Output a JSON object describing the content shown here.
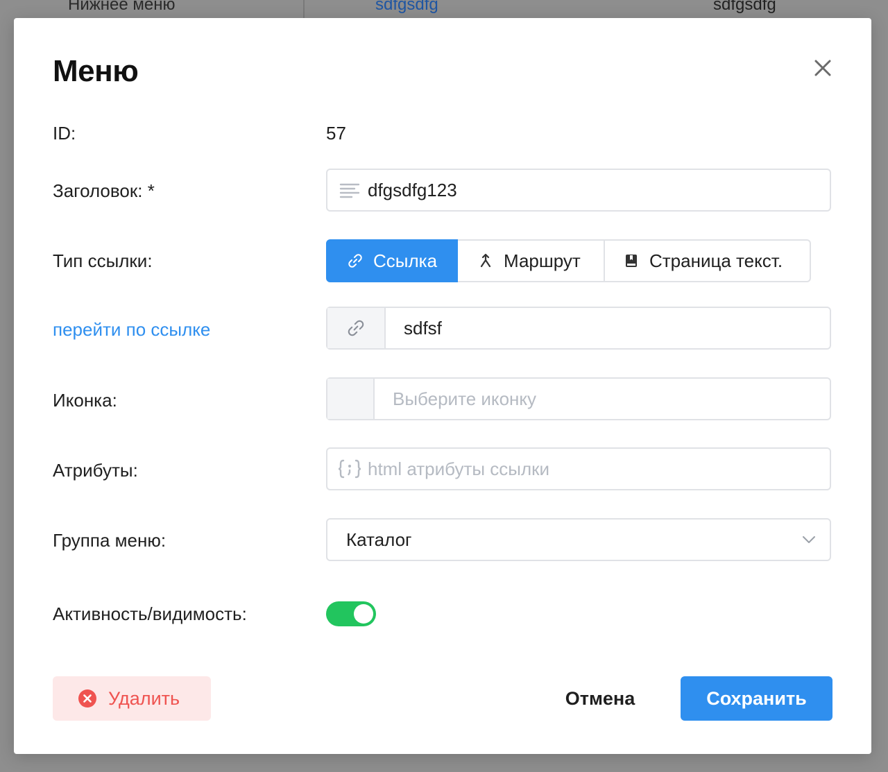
{
  "background": {
    "row_left": "Нижнее меню",
    "row_link": "sdfgsdfg",
    "row_right": "sdfgsdfg"
  },
  "modal": {
    "title": "Меню",
    "id_label": "ID:",
    "id_value": "57",
    "title_label": "Заголовок: *",
    "title_value": "dfgsdfg123",
    "link_type_label": "Тип ссылки:",
    "link_types": [
      {
        "label": "Ссылка",
        "icon": "link-icon",
        "active": true
      },
      {
        "label": "Маршрут",
        "icon": "route-icon",
        "active": false
      },
      {
        "label": "Страница текст.",
        "icon": "book-icon",
        "active": false
      }
    ],
    "goto_link_label": "перейти по ссылке",
    "url_value": "sdfsf",
    "icon_label": "Иконка:",
    "icon_placeholder": "Выберите иконку",
    "attributes_label": "Атрибуты:",
    "attributes_placeholder": "html атрибуты ссылки",
    "menu_group_label": "Группа меню:",
    "menu_group_value": "Каталог",
    "active_label": "Активность/видимость:",
    "active_enabled": true,
    "delete_label": "Удалить",
    "cancel_label": "Отмена",
    "save_label": "Сохранить"
  },
  "colors": {
    "accent": "#2f8fef",
    "toggle_on": "#22c55e",
    "danger": "#ef5350",
    "danger_bg": "#fde8e8"
  }
}
